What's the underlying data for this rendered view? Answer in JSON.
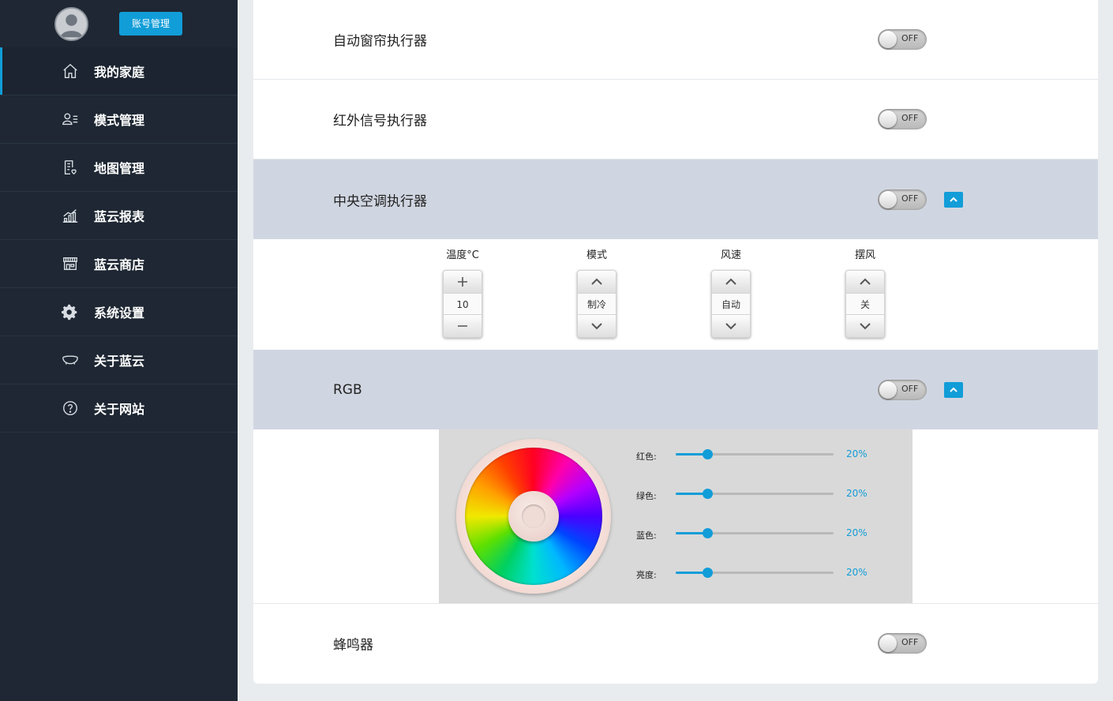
{
  "sidebar": {
    "account_button": "账号管理",
    "items": [
      {
        "label": "我的家庭",
        "icon": "home-icon"
      },
      {
        "label": "模式管理",
        "icon": "user-list-icon"
      },
      {
        "label": "地图管理",
        "icon": "map-doc-icon"
      },
      {
        "label": "蓝云报表",
        "icon": "chart-icon"
      },
      {
        "label": "蓝云商店",
        "icon": "store-icon"
      },
      {
        "label": "系统设置",
        "icon": "gear-icon"
      },
      {
        "label": "关于蓝云",
        "icon": "cloud-icon"
      },
      {
        "label": "关于网站",
        "icon": "question-icon"
      }
    ],
    "active_index": 0
  },
  "devices": {
    "curtain": {
      "name": "自动窗帘执行器",
      "state": "OFF"
    },
    "infrared": {
      "name": "红外信号执行器",
      "state": "OFF"
    },
    "ac": {
      "name": "中央空调执行器",
      "state": "OFF",
      "temperature": {
        "title": "温度°C",
        "value": "10"
      },
      "mode": {
        "title": "模式",
        "value": "制冷"
      },
      "fan_speed": {
        "title": "风速",
        "value": "自动"
      },
      "swing": {
        "title": "摆风",
        "value": "关"
      }
    },
    "rgb": {
      "name": "RGB",
      "state": "OFF",
      "sliders": [
        {
          "label": "红色:",
          "value": 20,
          "display": "20%"
        },
        {
          "label": "绿色:",
          "value": 20,
          "display": "20%"
        },
        {
          "label": "蓝色:",
          "value": 20,
          "display": "20%"
        },
        {
          "label": "亮度:",
          "value": 20,
          "display": "20%"
        }
      ]
    },
    "buzzer": {
      "name": "蜂鸣器",
      "state": "OFF"
    }
  },
  "colors": {
    "accent": "#119dd8",
    "sidebar_bg": "#1e2733",
    "shaded_row": "#d0d6e1"
  }
}
